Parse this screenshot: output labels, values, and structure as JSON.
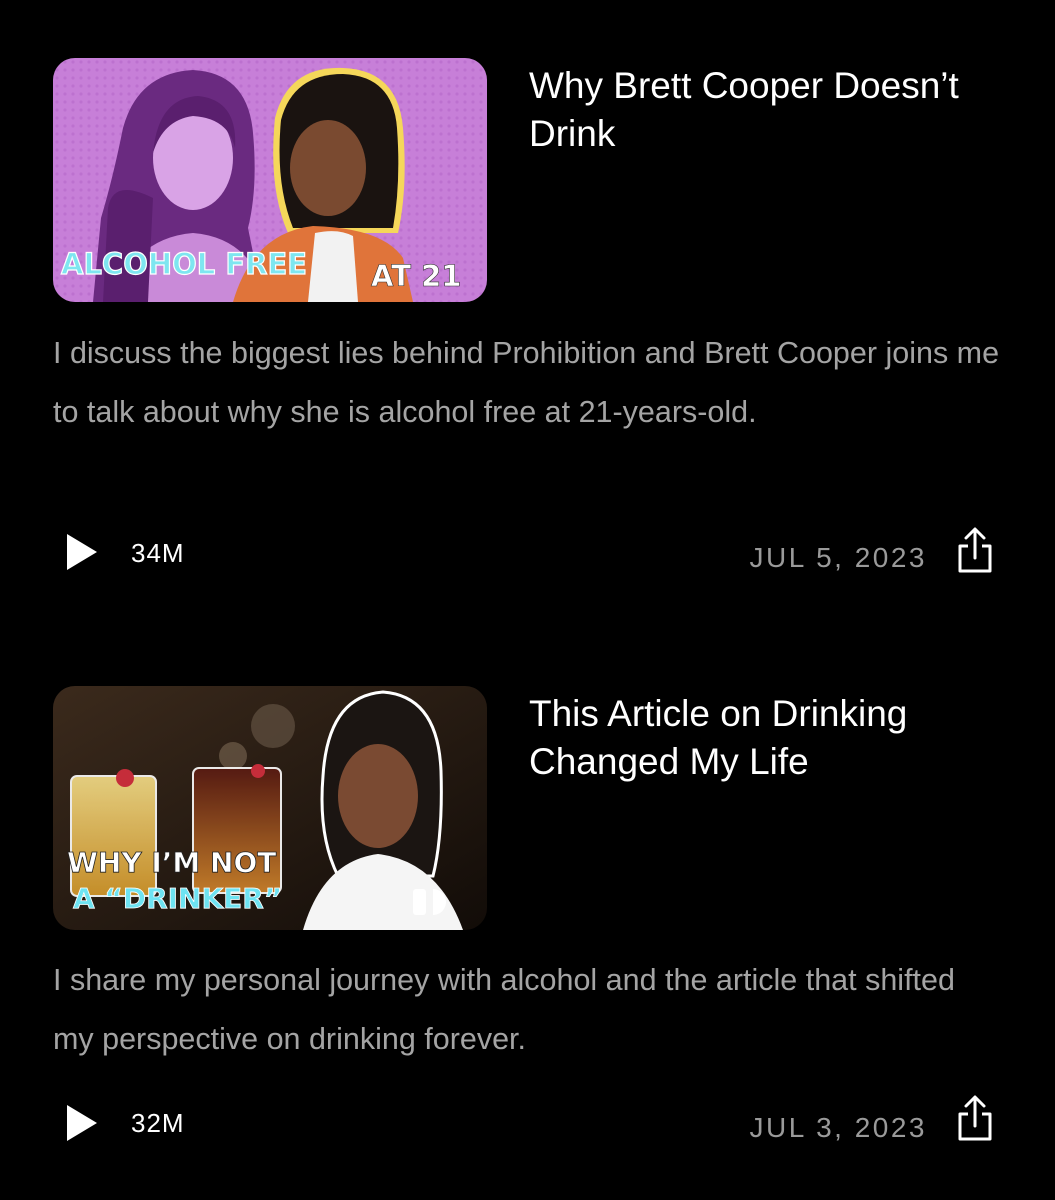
{
  "episodes": [
    {
      "title": "Why Brett Cooper Doesn’t Drink",
      "thumbnail_text": [
        "ALCOHOL FREE",
        "AT 21"
      ],
      "description": "I discuss the biggest lies behind Prohibition and Brett Cooper joins me to talk about why she is alcohol free at 21-years-old.",
      "views": "34M",
      "date": "JUL 5, 2023"
    },
    {
      "title": "This Article on Drinking Changed My Life",
      "thumbnail_text": [
        "WHY I’M NOT",
        "A “DRINKER”"
      ],
      "description": "I share my personal journey with alcohol and the article that shifted my perspective on drinking forever.",
      "views": "32M",
      "date": "JUL 3, 2023"
    }
  ],
  "icons": {
    "play": "play-icon",
    "share": "share-icon",
    "logo": "daily-wire-logo-icon"
  },
  "colors": {
    "background": "#000000",
    "title": "#ffffff",
    "description": "#a4a4a4",
    "date": "#9a9a9a",
    "thumb1_bg": "#c77fd8",
    "thumb1_text": "#7ee6f0",
    "thumb2_text": "#6ee3f2"
  }
}
